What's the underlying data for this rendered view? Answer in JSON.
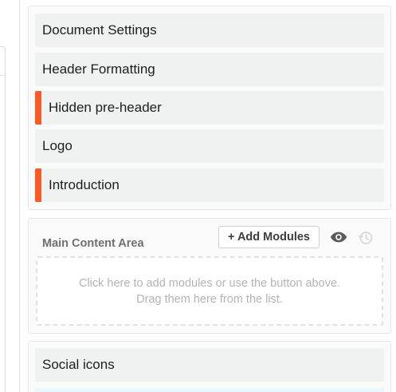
{
  "top_modules": [
    {
      "label": "Document Settings",
      "flag_color": null
    },
    {
      "label": "Header Formatting",
      "flag_color": null
    },
    {
      "label": "Hidden pre-header",
      "flag_color": "#fa5a28"
    },
    {
      "label": "Logo",
      "flag_color": null
    },
    {
      "label": "Introduction",
      "flag_color": "#fa5a28"
    }
  ],
  "main_area": {
    "title": "Main Content Area",
    "add_button": "+ Add Modules",
    "icons": [
      "eye-icon",
      "history-icon"
    ],
    "drop_zone_text": "Click here to add modules or use the button above. Drag them here from the list."
  },
  "bottom_modules": [
    {
      "label": "Social icons"
    }
  ],
  "colors": {
    "flag": "#fa5a28",
    "module_bg": "#f0f1f1",
    "section_bg": "#fafafa",
    "drop_text": "#b4b4b4"
  }
}
